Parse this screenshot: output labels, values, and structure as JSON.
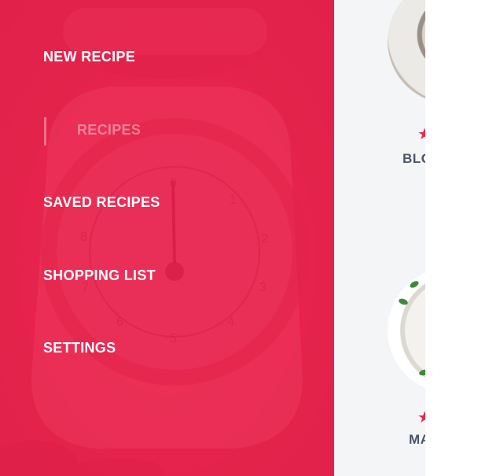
{
  "drawer": {
    "accent_color": "#e8284f",
    "items": [
      {
        "label": "NEW RECIPE",
        "active": false
      },
      {
        "label": "RECIPES",
        "active": true
      },
      {
        "label": "SAVED RECIPES",
        "active": false
      },
      {
        "label": "SHOPPING LIST",
        "active": false
      },
      {
        "label": "SETTINGS",
        "active": false
      }
    ]
  },
  "recipes": [
    {
      "name_visible": "BLO",
      "rating_icon": "star-icon",
      "star_color": "#e8284f"
    },
    {
      "name_visible": "MA",
      "rating_icon": "star-icon",
      "star_color": "#e8284f"
    }
  ]
}
